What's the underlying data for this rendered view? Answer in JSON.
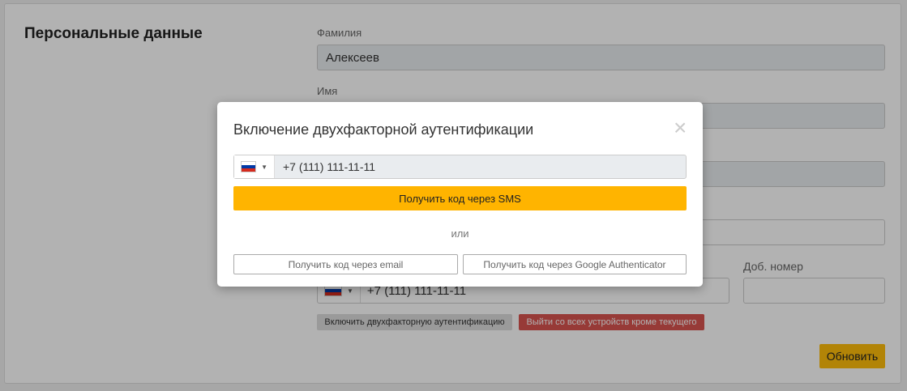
{
  "page": {
    "section_title": "Персональные данные",
    "fields": {
      "last_name_label": "Фамилия",
      "last_name_value": "Алексеев",
      "first_name_label": "Имя",
      "ext_label": "Доб. номер",
      "phone_value": "+7 (111) 111-11-11"
    },
    "enable_2fa_button": "Включить двухфакторную аутентификацию",
    "logout_others_button": "Выйти со всех устройств кроме текущего",
    "update_button": "Обновить"
  },
  "modal": {
    "title": "Включение двухфакторной аутентификации",
    "close": "×",
    "phone_value": "+7 (111) 111-11-11",
    "country_caret": "▼",
    "sms_button": "Получить код через SMS",
    "or_text": "или",
    "email_button": "Получить код через email",
    "google_button": "Получить код через Google Authenticator"
  },
  "colors": {
    "accent": "#ffb400",
    "danger": "#d9534f"
  }
}
